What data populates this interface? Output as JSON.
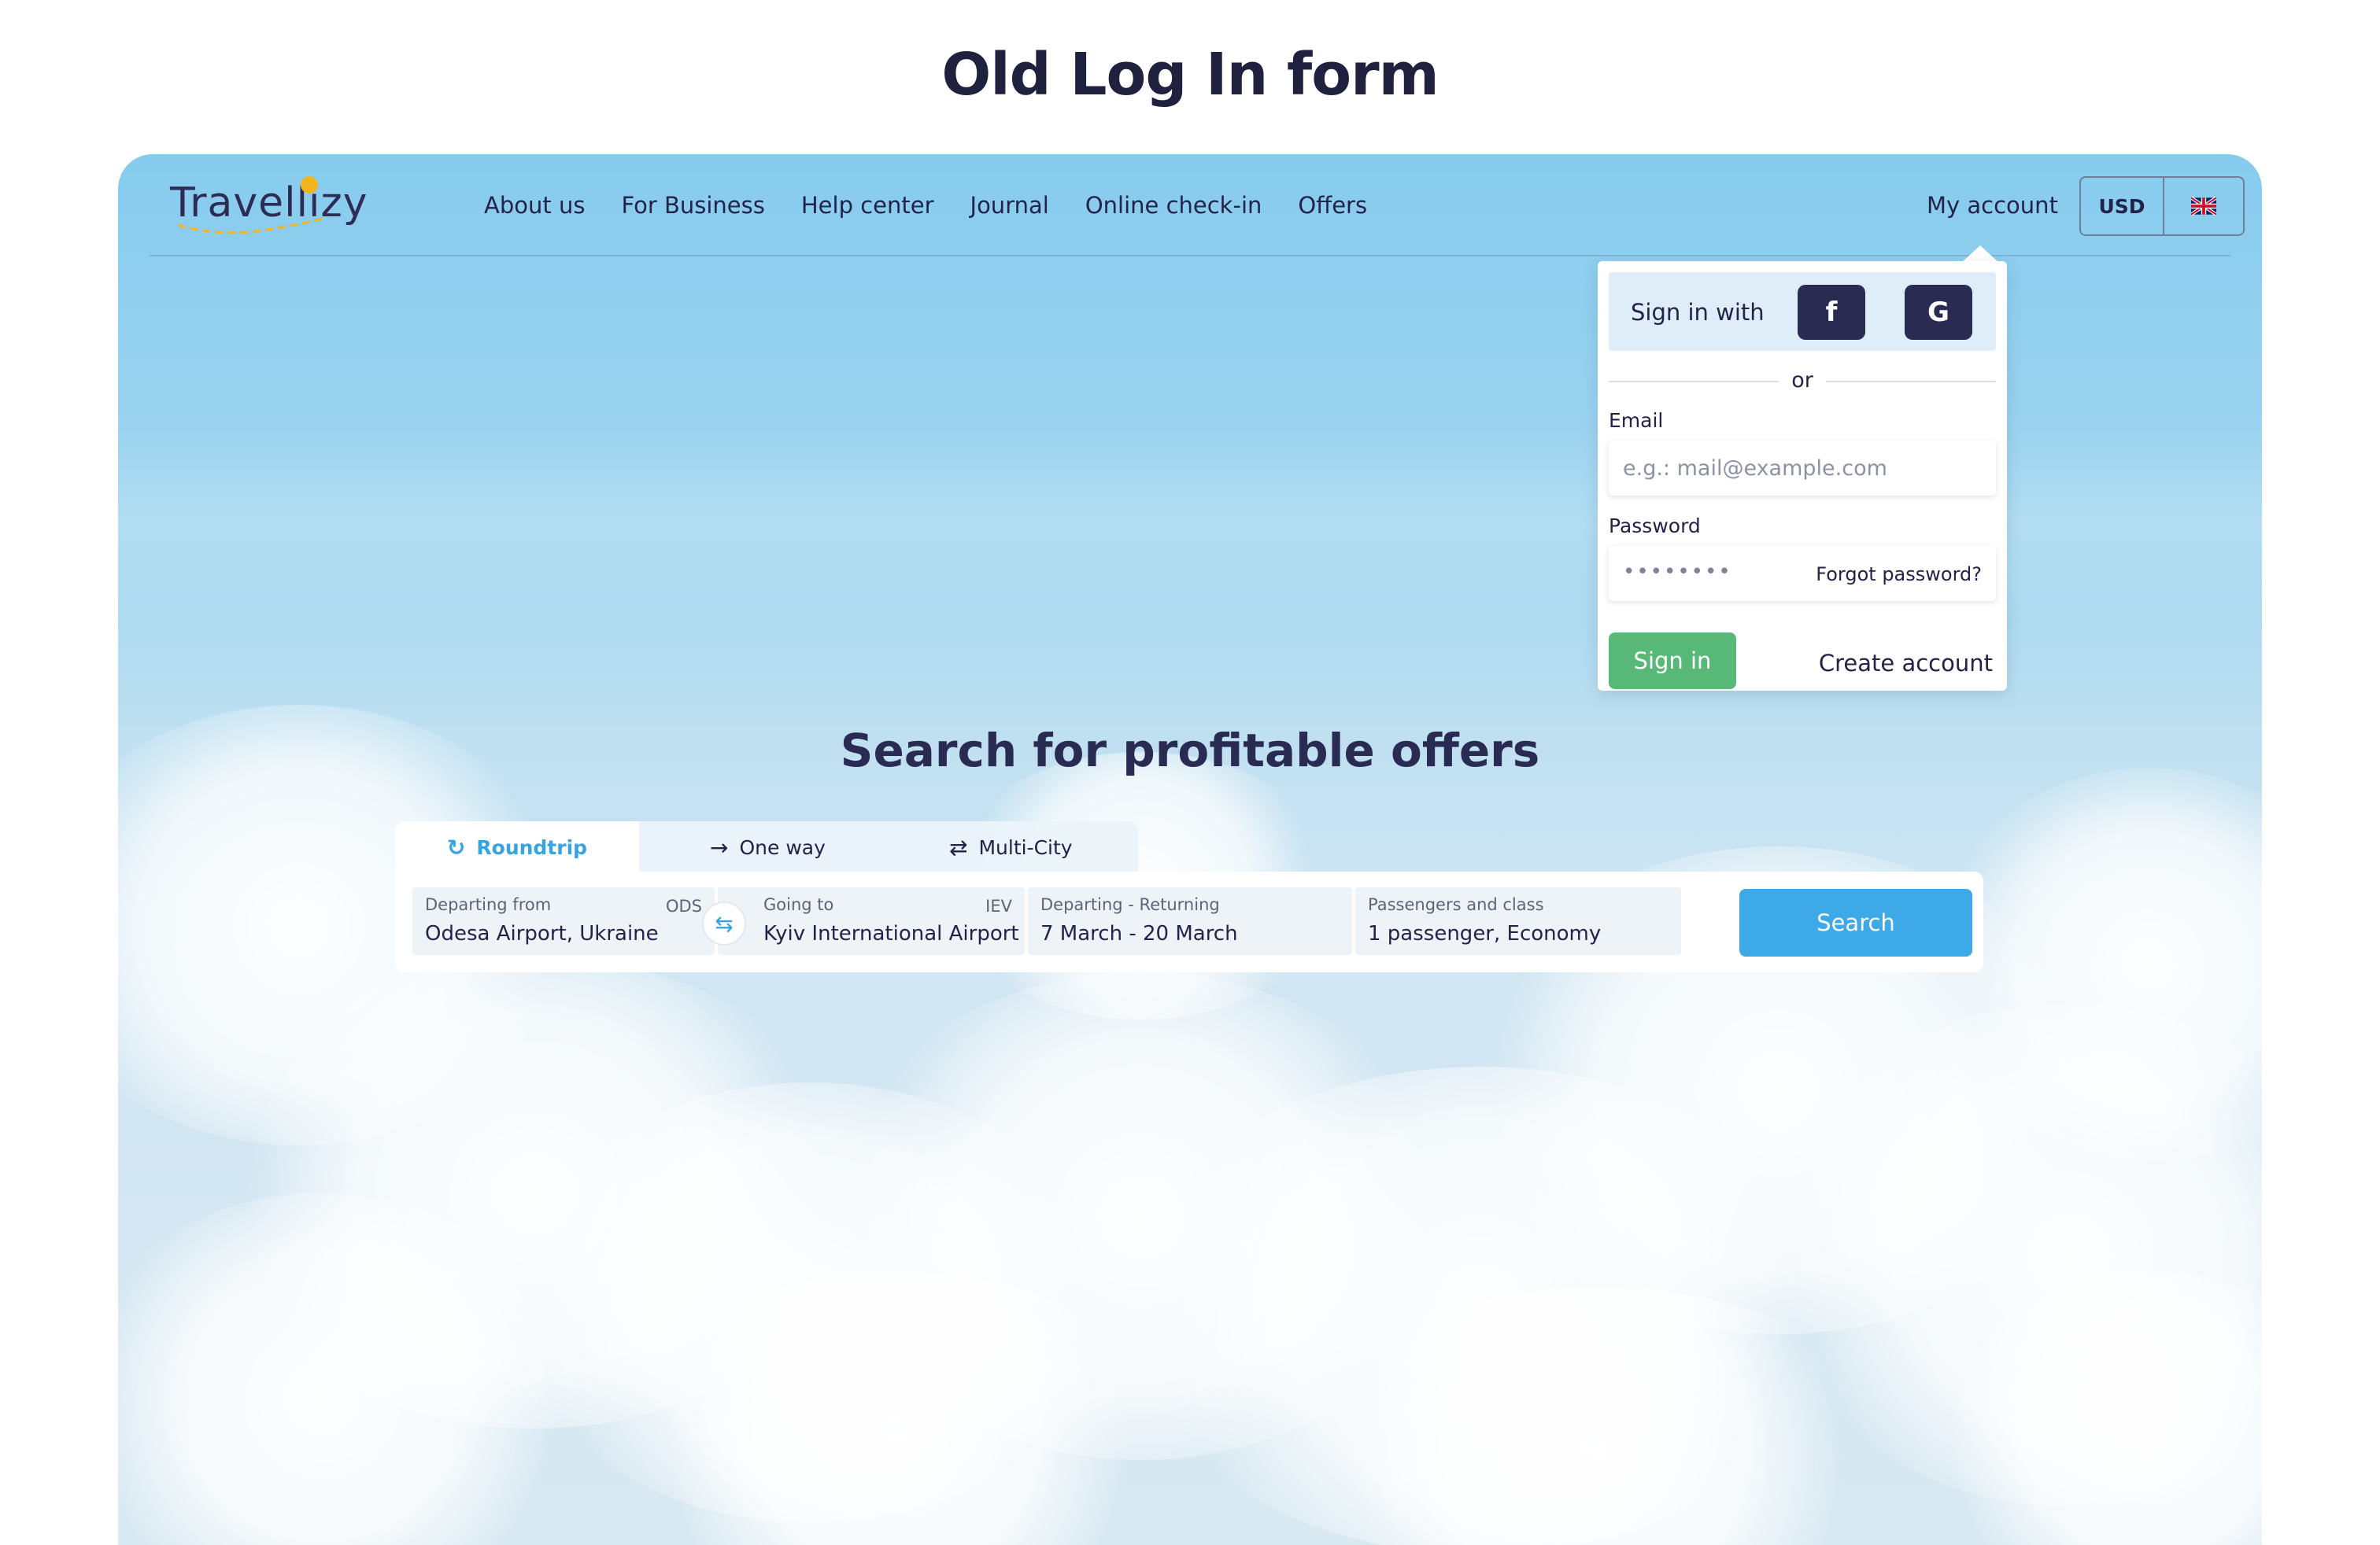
{
  "page_heading": "Old Log In form",
  "header": {
    "logo_text": "Travellizy",
    "nav": [
      "About us",
      "For Business",
      "Help center",
      "Journal",
      "Online check-in",
      "Offers"
    ],
    "my_account": "My account",
    "currency": "USD",
    "language_icon": "uk-flag-icon"
  },
  "login": {
    "sign_in_with": "Sign in with",
    "facebook_glyph": "f",
    "google_glyph": "G",
    "or": "or",
    "email_label": "Email",
    "email_placeholder": "e.g.: mail@example.com",
    "password_label": "Password",
    "password_mask": "••••••••",
    "forgot": "Forgot password?",
    "sign_in_button": "Sign in",
    "create_account": "Create account"
  },
  "search": {
    "title": "Search for profitable offers",
    "tabs": [
      {
        "label": "Roundtrip",
        "icon": "roundtrip-icon",
        "active": true
      },
      {
        "label": "One way",
        "icon": "arrow-right-icon",
        "active": false
      },
      {
        "label": "Multi-City",
        "icon": "swap-arrows-icon",
        "active": false
      }
    ],
    "from": {
      "label": "Departing from",
      "value": "Odesa Airport, Ukraine",
      "code": "ODS"
    },
    "to": {
      "label": "Going to",
      "value": "Kyiv International Airport",
      "code": "IEV"
    },
    "dates": {
      "label": "Departing - Returning",
      "value": "7 March - 20 March"
    },
    "passengers": {
      "label": "Passengers and class",
      "value": "1 passenger, Economy"
    },
    "search_button": "Search"
  },
  "colors": {
    "primary_dark": "#2a2b52",
    "accent_blue": "#3daae7",
    "sign_in_green": "#58b878"
  }
}
